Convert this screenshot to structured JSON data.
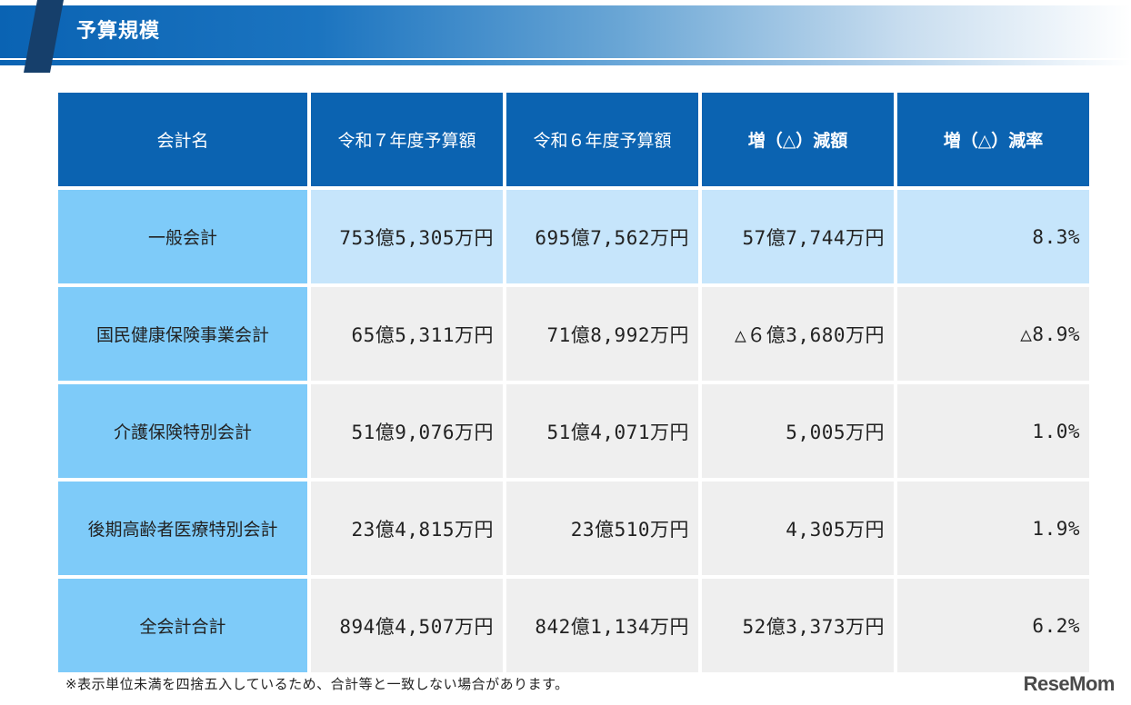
{
  "header": {
    "title": "予算規模"
  },
  "table": {
    "columns": [
      "会計名",
      "令和７年度予算額",
      "令和６年度予算額",
      "増（△）減額",
      "増（△）減率"
    ],
    "rows": [
      {
        "name": "一般会計",
        "r7": "753億5,305万円",
        "r6": "695億7,562万円",
        "diff": "57億7,744万円",
        "rate": "8.3%"
      },
      {
        "name": "国民健康保険事業会計",
        "r7": "65億5,311万円",
        "r6": "71億8,992万円",
        "diff": "△６億3,680万円",
        "rate": "△8.9%"
      },
      {
        "name": "介護保険特別会計",
        "r7": "51億9,076万円",
        "r6": "51億4,071万円",
        "diff": "5,005万円",
        "rate": "1.0%"
      },
      {
        "name": "後期高齢者医療特別会計",
        "r7": "23億4,815万円",
        "r6": "23億510万円",
        "diff": "4,305万円",
        "rate": "1.9%"
      },
      {
        "name": "全会計合計",
        "r7": "894億4,507万円",
        "r6": "842億1,134万円",
        "diff": "52億3,373万円",
        "rate": "6.2%"
      }
    ]
  },
  "footnote": "※表示単位未満を四捨五入しているため、合計等と一致しない場合があります。",
  "watermark": "ReseMom",
  "colors": {
    "header_blue": "#0b63b1",
    "name_cell_blue": "#7ecbf9",
    "highlight_row": "#c6e5fb",
    "gray_cell": "#efefef"
  }
}
